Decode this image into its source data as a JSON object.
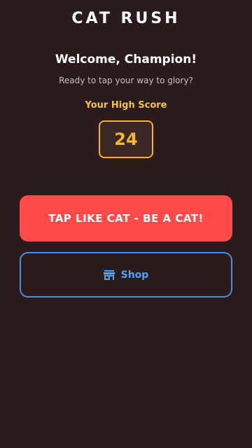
{
  "header": {
    "title": "CAT RUSH"
  },
  "welcome": {
    "heading": "Welcome, Champion!",
    "subtitle": "Ready to tap your way to glory?"
  },
  "high_score": {
    "label": "Your High Score",
    "value": "24"
  },
  "actions": {
    "play_label": "TAP LIKE CAT - BE A CAT!",
    "shop_label": "Shop",
    "shop_icon": "store-icon"
  },
  "colors": {
    "background": "#2c1b1c",
    "accent_red": "#ff4a4a",
    "accent_gold": "#f2b42d",
    "accent_blue": "#4a90e2"
  }
}
